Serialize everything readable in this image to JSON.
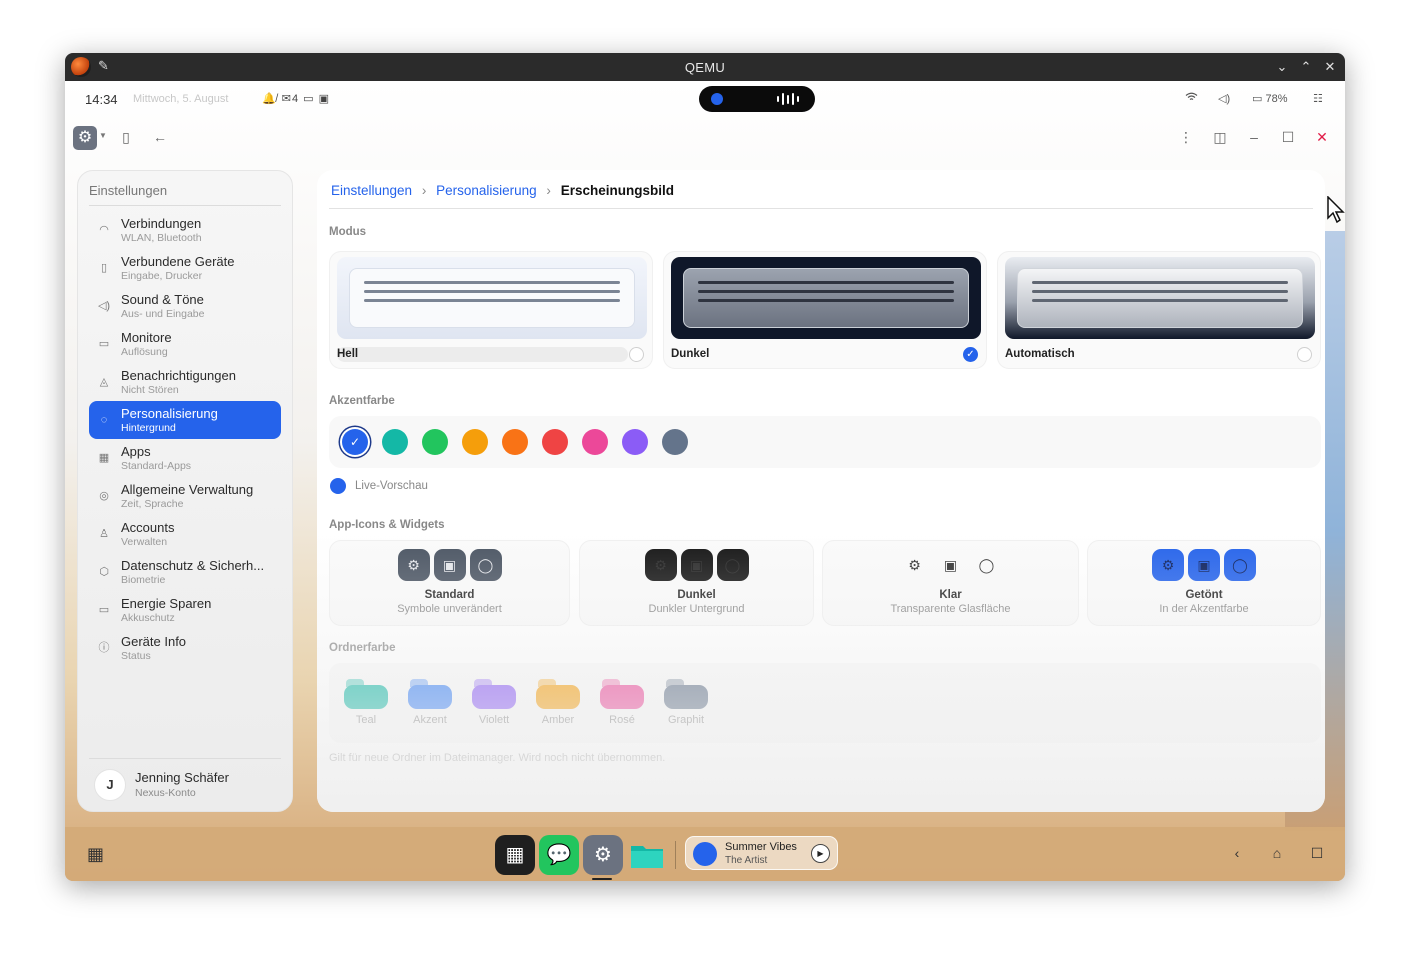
{
  "window": {
    "title": "QEMU"
  },
  "statusbar": {
    "time": "14:34",
    "date": "Mittwoch, 5. August",
    "notif_icons": "🔔̸ ✉4 ▭ ▣",
    "battery": "78%"
  },
  "sidebar": {
    "title": "Einstellungen",
    "items": [
      {
        "label": "Verbindungen",
        "sub": "WLAN, Bluetooth",
        "icon": "wifi-icon",
        "glyph": "◠"
      },
      {
        "label": "Verbundene Geräte",
        "sub": "Eingabe, Drucker",
        "icon": "device-icon",
        "glyph": "▯"
      },
      {
        "label": "Sound & Töne",
        "sub": "Aus- und Eingabe",
        "icon": "speaker-icon",
        "glyph": "◁)"
      },
      {
        "label": "Monitore",
        "sub": "Auflösung",
        "icon": "monitor-icon",
        "glyph": "▭"
      },
      {
        "label": "Benachrichtigungen",
        "sub": "Nicht Stören",
        "icon": "bell-icon",
        "glyph": "◬"
      },
      {
        "label": "Personalisierung",
        "sub": "Hintergrund",
        "icon": "palette-icon",
        "glyph": "◌",
        "active": true
      },
      {
        "label": "Apps",
        "sub": "Standard-Apps",
        "icon": "apps-grid-icon",
        "glyph": "▦"
      },
      {
        "label": "Allgemeine Verwaltung",
        "sub": "Zeit, Sprache",
        "icon": "globe-icon",
        "glyph": "◎"
      },
      {
        "label": "Accounts",
        "sub": "Verwalten",
        "icon": "user-icon",
        "glyph": "♙"
      },
      {
        "label": "Datenschutz & Sicherh...",
        "sub": "Biometrie",
        "icon": "shield-icon",
        "glyph": "⬡"
      },
      {
        "label": "Energie Sparen",
        "sub": "Akkuschutz",
        "icon": "battery-icon",
        "glyph": "▭"
      },
      {
        "label": "Geräte Info",
        "sub": "Status",
        "icon": "info-icon",
        "glyph": "ⓘ"
      }
    ],
    "user": {
      "initial": "J",
      "name": "Jenning Schäfer",
      "sub": "Nexus-Konto"
    }
  },
  "breadcrumb": {
    "root": "Einstellungen",
    "parent": "Personalisierung",
    "current": "Erscheinungsbild"
  },
  "mode": {
    "heading": "Modus",
    "options": [
      {
        "label": "Hell",
        "selected": false
      },
      {
        "label": "Dunkel",
        "selected": true
      },
      {
        "label": "Automatisch",
        "selected": false
      }
    ]
  },
  "accent": {
    "heading": "Akzentfarbe",
    "colors": [
      "#2563eb",
      "#14b8a6",
      "#22c55e",
      "#f59e0b",
      "#f97316",
      "#ef4444",
      "#ec4899",
      "#8b5cf6",
      "#64748b"
    ],
    "selected_index": 0,
    "live_label": "Live-Vorschau"
  },
  "app_icons": {
    "heading": "App-Icons & Widgets",
    "options": [
      {
        "title": "Standard",
        "sub": "Symbole unverändert"
      },
      {
        "title": "Dunkel",
        "sub": "Dunkler Untergrund"
      },
      {
        "title": "Klar",
        "sub": "Transparente Glasfläche"
      },
      {
        "title": "Getönt",
        "sub": "In der Akzentfarbe"
      }
    ]
  },
  "folder_color": {
    "heading": "Ordnerfarbe",
    "options": [
      {
        "label": "Teal",
        "color": "#14b8a6"
      },
      {
        "label": "Akzent",
        "color": "#3b82f6"
      },
      {
        "label": "Violett",
        "color": "#8b5cf6"
      },
      {
        "label": "Amber",
        "color": "#f59e0b"
      },
      {
        "label": "Rosé",
        "color": "#ec4899"
      },
      {
        "label": "Graphit",
        "color": "#64748b"
      }
    ],
    "note": "Gilt für neue Ordner im Dateimanager. Wird noch nicht übernommen."
  },
  "media": {
    "title": "Summer Vibes",
    "artist": "The Artist"
  }
}
